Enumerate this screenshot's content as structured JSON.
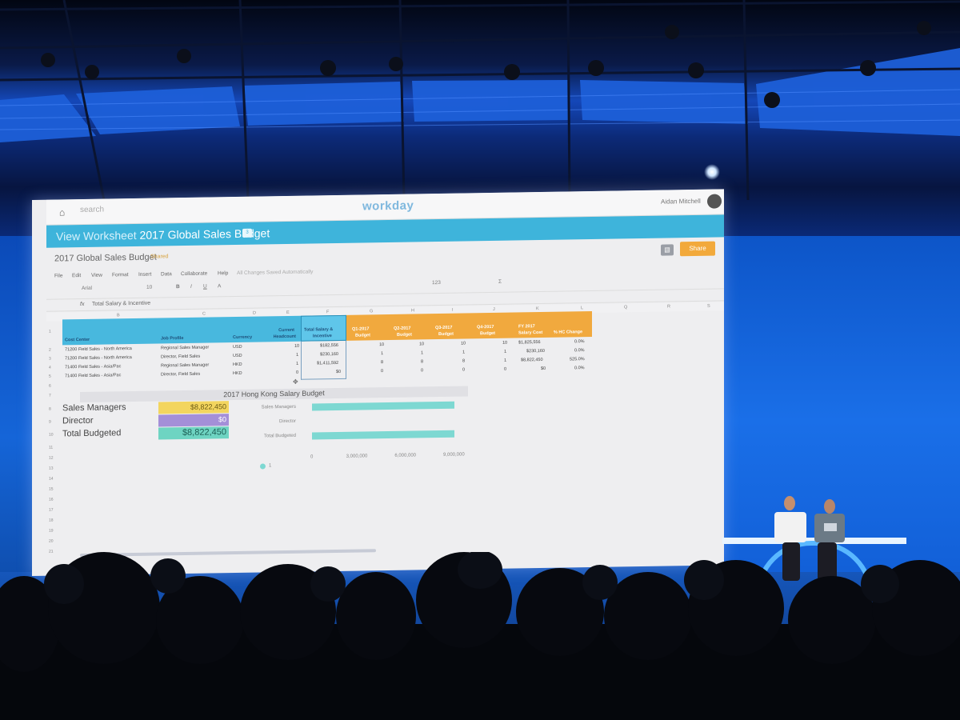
{
  "app": {
    "logo": "workday",
    "search_placeholder": "search",
    "user_name": "Aidan Mitchell",
    "home_glyph": "⌂",
    "search_glyph": "⚲"
  },
  "titlebar": {
    "prefix": "View Worksheet",
    "title": "2017 Global Sales Budget",
    "badge": "3"
  },
  "document": {
    "title": "2017 Global Sales Budget",
    "shared_label": "Shared",
    "share_button": "Share",
    "chat_glyph": "▤"
  },
  "menu": [
    "File",
    "Edit",
    "View",
    "Format",
    "Insert",
    "Data",
    "Collaborate",
    "Help",
    "All Changes Saved Automatically"
  ],
  "toolbar": {
    "font": "Arial",
    "size": "10",
    "buttons": [
      "B",
      "I",
      "U",
      "A",
      "123",
      "Σ"
    ]
  },
  "formula": {
    "fx": "fx",
    "value": "Total Salary & Incentive"
  },
  "columns": [
    "B",
    "C",
    "D",
    "E",
    "F",
    "G",
    "H",
    "I",
    "J",
    "K",
    "L",
    "Q",
    "R",
    "S"
  ],
  "rows": [
    "1",
    "2",
    "3",
    "4",
    "5",
    "6",
    "7",
    "8",
    "9",
    "10",
    "11",
    "12",
    "13",
    "14",
    "15",
    "16",
    "17",
    "18",
    "19",
    "20",
    "21"
  ],
  "table": {
    "headers": {
      "cost_center": "Cost Center",
      "job_profile": "Job Profile",
      "currency": "Currency",
      "current": "Current",
      "headcount": "Headcount",
      "total_salary": "Total Salary &",
      "incentive": "Incentive",
      "q1a": "Q1-2017",
      "q1b": "Budget",
      "q2a": "Q2-2017",
      "q2b": "Budget",
      "q3a": "Q3-2017",
      "q3b": "Budget",
      "q4a": "Q4-2017",
      "q4b": "Budget",
      "fya": "FY 2017",
      "fyb": "Salary Cost",
      "hc": "% HC Change"
    },
    "rows": [
      {
        "cost_center": "71200 Field Sales - North America",
        "job_profile": "Regional Sales Manager",
        "currency": "USD",
        "headcount": "10",
        "total": "$182,556",
        "q1": "10",
        "q2": "10",
        "q3": "10",
        "q4": "10",
        "fy": "$1,825,556",
        "hc": "0.0%"
      },
      {
        "cost_center": "71200 Field Sales - North America",
        "job_profile": "Director, Field Sales",
        "currency": "USD",
        "headcount": "1",
        "total": "$230,160",
        "q1": "1",
        "q2": "1",
        "q3": "1",
        "q4": "1",
        "fy": "$230,160",
        "hc": "0.0%"
      },
      {
        "cost_center": "71400 Field Sales - Asia/Pac",
        "job_profile": "Regional Sales Manager",
        "currency": "HKD",
        "headcount": "1",
        "total": "$1,411,592",
        "q1": "8",
        "q2": "8",
        "q3": "8",
        "q4": "1",
        "fy": "$8,822,450",
        "hc": "525.0%"
      },
      {
        "cost_center": "71400 Field Sales - Asia/Pac",
        "job_profile": "Director, Field Sales",
        "currency": "HKD",
        "headcount": "0",
        "total": "$0",
        "q1": "0",
        "q2": "0",
        "q3": "0",
        "q4": "0",
        "fy": "$0",
        "hc": "0.0%"
      }
    ]
  },
  "hk": {
    "title": "2017 Hong Kong Salary Budget",
    "sales_managers_label": "Sales Managers",
    "sales_managers_value": "$8,822,450",
    "director_label": "Director",
    "director_value": "$0",
    "total_label": "Total Budgeted",
    "total_value": "$8,822,450",
    "legend": "1"
  },
  "colors": {
    "workday_blue": "#3eb4db",
    "header_orange": "#f1a93e",
    "share_orange": "#f2a93b",
    "bar_teal": "#7dd8d2"
  },
  "chart_data": {
    "type": "bar",
    "orientation": "horizontal",
    "categories": [
      "Sales Managers",
      "Director",
      "Total Budgeted"
    ],
    "values": [
      8822450,
      0,
      8822450
    ],
    "xlim": [
      0,
      9000000
    ],
    "xticks": [
      "0",
      "3,000,000",
      "6,000,000",
      "9,000,000"
    ],
    "legend": "1",
    "legend_position": "bottom-left"
  }
}
